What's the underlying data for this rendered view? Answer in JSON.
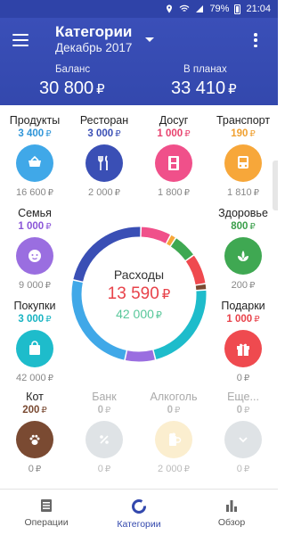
{
  "status": {
    "battery": "79%",
    "time": "21:04"
  },
  "header": {
    "title": "Категории",
    "period": "Декабрь 2017",
    "balance_label": "Баланс",
    "balance_value": "30 800",
    "planned_label": "В планах",
    "planned_value": "33 410",
    "currency": "₽"
  },
  "categories": [
    {
      "name": "Продукты",
      "amount": "3 400",
      "plan": "16 600",
      "color": "#40a8e8",
      "amount_color": "#2f95d8",
      "icon": "basket-icon"
    },
    {
      "name": "Ресторан",
      "amount": "3 000",
      "plan": "2 000",
      "color": "#3a4fb5",
      "amount_color": "#3a4fb5",
      "icon": "fork-knife-icon"
    },
    {
      "name": "Досуг",
      "amount": "1 000",
      "plan": "1 800",
      "color": "#f0508a",
      "amount_color": "#e8426e",
      "icon": "film-icon"
    },
    {
      "name": "Транспорт",
      "amount": "190",
      "plan": "1 810",
      "color": "#f7a73a",
      "amount_color": "#f0a030",
      "icon": "bus-icon"
    },
    {
      "name": "Семья",
      "amount": "1 000",
      "plan": "9 000",
      "color": "#9a6ee0",
      "amount_color": "#8a55d8",
      "icon": "baby-icon"
    },
    {
      "name": "Здоровье",
      "amount": "800",
      "plan": "200",
      "color": "#3fa852",
      "amount_color": "#3a9e4a",
      "icon": "leaf-icon"
    },
    {
      "name": "Покупки",
      "amount": "3 000",
      "plan": "42 000",
      "color": "#1ebccb",
      "amount_color": "#17b3c2",
      "icon": "bag-icon"
    },
    {
      "name": "Подарки",
      "amount": "1 000",
      "plan": "0",
      "color": "#ef4a4f",
      "amount_color": "#e8424a",
      "icon": "gift-icon"
    },
    {
      "name": "Кот",
      "amount": "200",
      "plan": "0",
      "color": "#7a4a32",
      "amount_color": "#7a4a32",
      "icon": "paw-icon"
    },
    {
      "name": "Банк",
      "amount": "0",
      "plan": "0",
      "color": "#dfe3e6",
      "amount_color": "#bbbbbb",
      "icon": "percent-icon"
    },
    {
      "name": "Алкоголь",
      "amount": "0",
      "plan": "2 000",
      "color": "#fbeecf",
      "amount_color": "#bbbbbb",
      "icon": "beer-mug-icon"
    },
    {
      "name": "Еще...",
      "amount": "0",
      "plan": "0",
      "color": "#dfe3e6",
      "amount_color": "#bbbbbb",
      "icon": "chevron-down-icon"
    }
  ],
  "donut": {
    "label": "Расходы",
    "spent": "13 590",
    "planned": "42 000",
    "currency": "₽",
    "segments": [
      {
        "name": "Досуг",
        "value": 1000,
        "color": "#f0508a"
      },
      {
        "name": "Транспорт",
        "value": 190,
        "color": "#f7a73a"
      },
      {
        "name": "Здоровье",
        "value": 800,
        "color": "#3fa852"
      },
      {
        "name": "Подарки",
        "value": 1000,
        "color": "#ef4a4f"
      },
      {
        "name": "Кот",
        "value": 200,
        "color": "#7a4a32"
      },
      {
        "name": "Покупки",
        "value": 3000,
        "color": "#1ebccb"
      },
      {
        "name": "Семья",
        "value": 1000,
        "color": "#9a6ee0"
      },
      {
        "name": "Продукты",
        "value": 3400,
        "color": "#40a8e8"
      },
      {
        "name": "Ресторан",
        "value": 3000,
        "color": "#3a4fb5"
      }
    ]
  },
  "nav": [
    {
      "label": "Операции",
      "icon": "list-icon"
    },
    {
      "label": "Категории",
      "icon": "donut-icon",
      "active": true
    },
    {
      "label": "Обзор",
      "icon": "bar-chart-icon"
    }
  ]
}
